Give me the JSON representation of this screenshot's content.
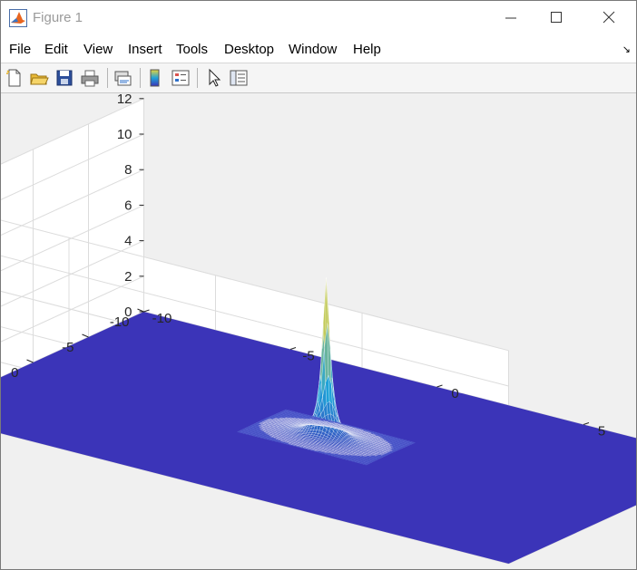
{
  "window": {
    "title": "Figure 1"
  },
  "menu": {
    "items": [
      {
        "id": "file",
        "label": "File"
      },
      {
        "id": "edit",
        "label": "Edit"
      },
      {
        "id": "view",
        "label": "View"
      },
      {
        "id": "insert",
        "label": "Insert"
      },
      {
        "id": "tools",
        "label": "Tools"
      },
      {
        "id": "desktop",
        "label": "Desktop"
      },
      {
        "id": "window",
        "label": "Window"
      },
      {
        "id": "help",
        "label": "Help"
      }
    ]
  },
  "toolbar": {
    "icons": [
      "new-figure-icon",
      "open-file-icon",
      "save-icon",
      "print-icon",
      "link-plot-icon",
      "insert-colorbar-icon",
      "insert-legend-icon",
      "edit-plot-icon",
      "property-inspector-icon"
    ]
  },
  "chart_data": {
    "type": "surface",
    "title": "",
    "xlabel": "",
    "ylabel": "",
    "zlabel": "",
    "xlim": [
      -10,
      10
    ],
    "ylim": [
      -10,
      10
    ],
    "zlim": [
      0,
      12
    ],
    "xticks": [
      -10,
      -5,
      0,
      5,
      10
    ],
    "yticks": [
      -10,
      -5,
      0,
      5,
      10
    ],
    "zticks": [
      0,
      2,
      4,
      6,
      8,
      10,
      12
    ],
    "grid": true,
    "colormap": "parula",
    "peak": {
      "x": 0,
      "y": 0,
      "z": 9
    },
    "colors": {
      "base": "#3b34b8",
      "mid": "#1fa2d8",
      "top": "#e8d43a"
    }
  }
}
